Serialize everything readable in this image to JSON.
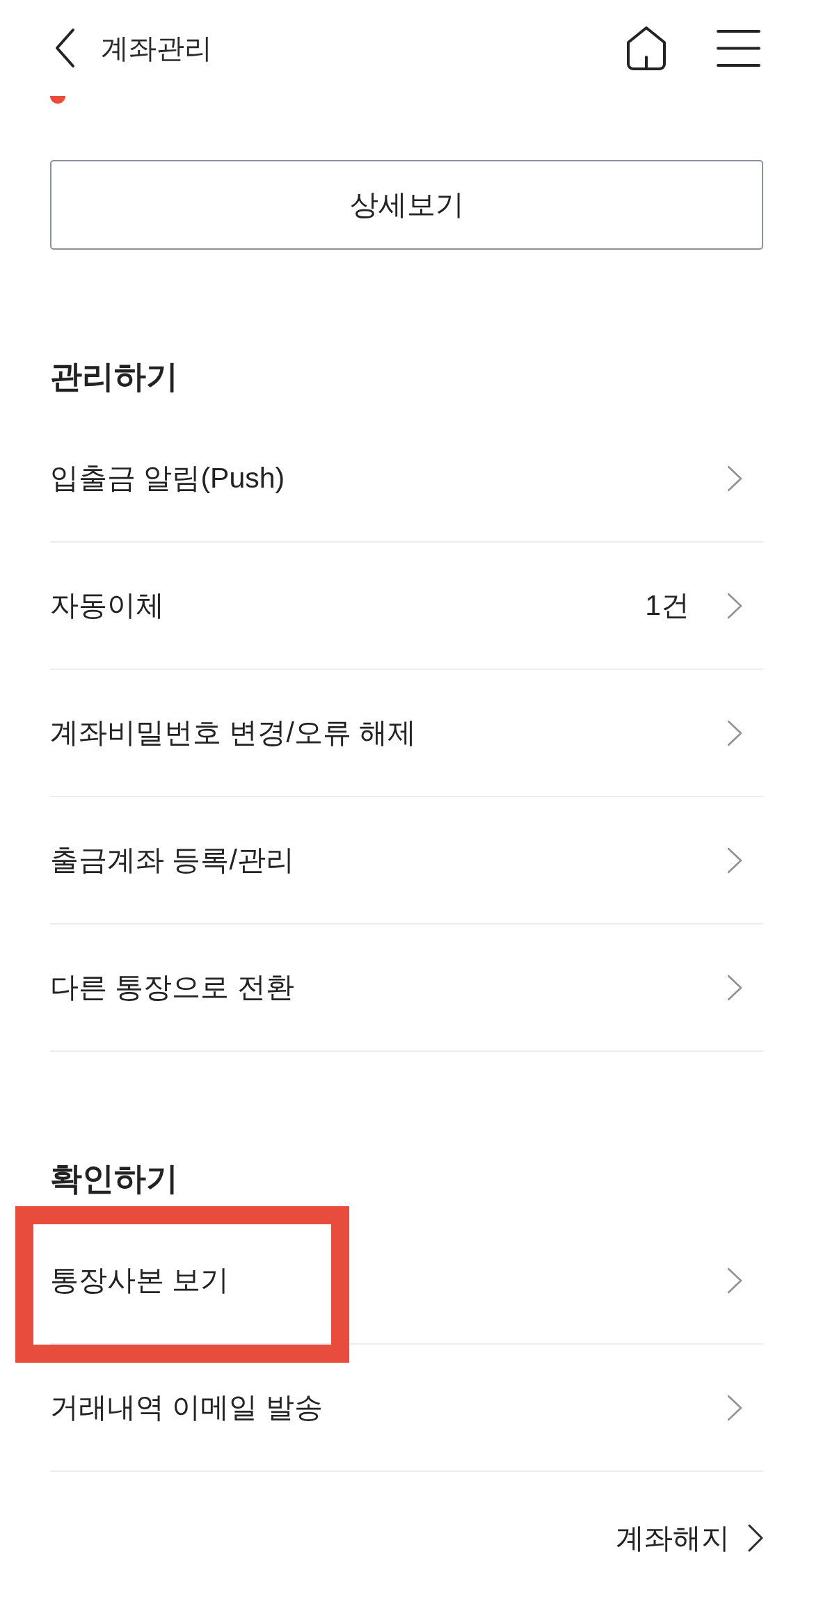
{
  "header": {
    "title": "계좌관리"
  },
  "cut_off_row": {
    "dot": true
  },
  "detail_button": {
    "label": "상세보기"
  },
  "sections": [
    {
      "title": "관리하기",
      "items": [
        {
          "label": "입출금 알림(Push)",
          "highlighted": false
        },
        {
          "label": "자동이체",
          "value": "1건",
          "highlighted": false
        },
        {
          "label": "계좌비밀번호 변경/오류 해제",
          "highlighted": false
        },
        {
          "label": "출금계좌 등록/관리",
          "highlighted": false
        },
        {
          "label": "다른 통장으로 전환",
          "highlighted": false
        }
      ]
    },
    {
      "title": "확인하기",
      "items": [
        {
          "label": "통장사본 보기",
          "highlighted": true
        },
        {
          "label": "거래내역 이메일 발송",
          "highlighted": false
        }
      ]
    }
  ],
  "footer_link": {
    "label": "계좌해지"
  }
}
